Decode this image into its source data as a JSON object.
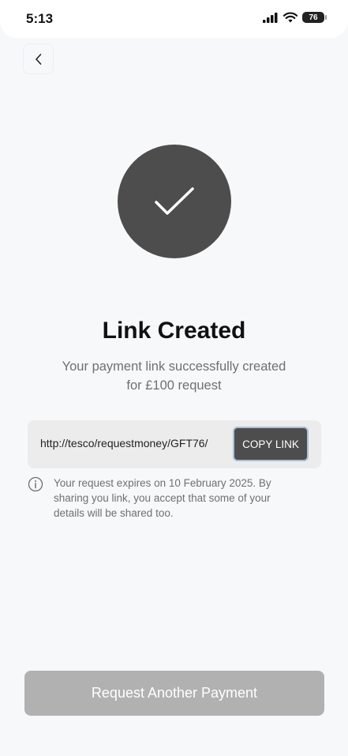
{
  "status_bar": {
    "time": "5:13",
    "battery": "76",
    "icons": [
      "signal-icon",
      "wifi-icon",
      "battery-icon"
    ]
  },
  "header": {
    "back_icon": "chevron-left-icon"
  },
  "success": {
    "icon": "checkmark-icon",
    "title": "Link Created",
    "subtitle": "Your payment link successfully created for £100 request"
  },
  "link": {
    "url": "http://tesco/requestmoney/GFT76/",
    "copy_label": "COPY LINK"
  },
  "info": {
    "icon": "info-icon",
    "text": "Your request expires on 10 February 2025. By sharing you link, you accept that some of your details will be shared too."
  },
  "footer": {
    "request_label": "Request Another Payment"
  },
  "colors": {
    "background": "#f7f8fa",
    "circle": "#4d4d4d",
    "button_disabled": "#b1b1b1",
    "copy_button": "#4d4d4d",
    "copy_border": "#a9c1d9"
  }
}
